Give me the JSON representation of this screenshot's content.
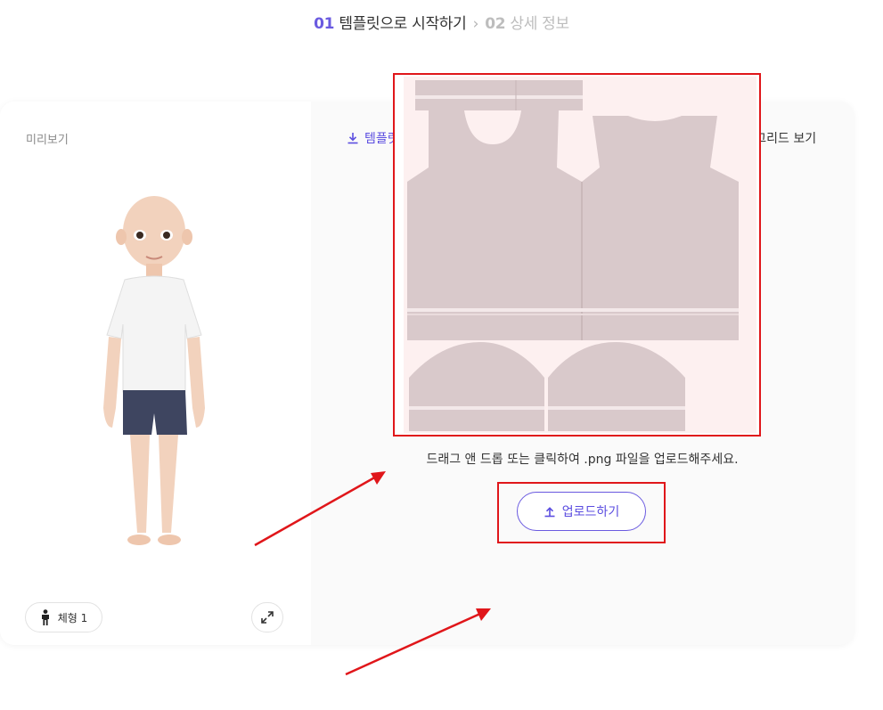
{
  "stepper": {
    "step1_number": "01",
    "step1_label": "템플릿으로 시작하기",
    "separator": "›",
    "step2_number": "02",
    "step2_label": "상세 정보"
  },
  "preview": {
    "title": "미리보기",
    "body_type_label": "체형 1"
  },
  "editor": {
    "download_label": "템플릿 다운로드",
    "uv_grid_label": "UV 그리드 보기",
    "hint": "드래그 앤 드롭 또는 클릭하여 .png 파일을 업로드해주세요.",
    "upload_label": "업로드하기"
  },
  "colors": {
    "accent": "#6a5ae0",
    "annotation": "#e0161a",
    "template_bg": "#fdf0f0",
    "template_piece": "#d9c9cb"
  },
  "icons": [
    "download-icon",
    "person-icon",
    "expand-icon",
    "upload-icon"
  ]
}
